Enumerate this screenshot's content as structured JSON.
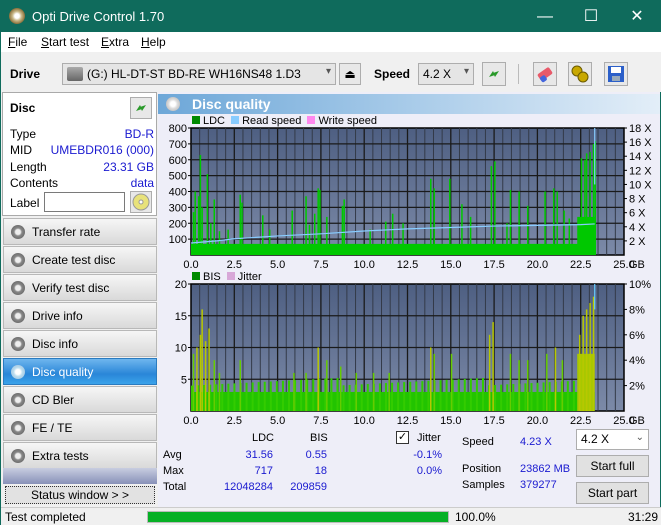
{
  "window": {
    "title": "Opti Drive Control 1.70",
    "minimize": "—",
    "maximize": "☐",
    "close": "✕"
  },
  "menu": [
    {
      "label": "File",
      "ul": "F",
      "rest": "ile"
    },
    {
      "label": "Start test",
      "ul": "S",
      "rest": "tart test"
    },
    {
      "label": "Extra",
      "ul": "E",
      "rest": "xtra"
    },
    {
      "label": "Help",
      "ul": "H",
      "rest": "elp"
    }
  ],
  "toolbar": {
    "drive_label": "Drive",
    "drive_value": "(G:)  HL-DT-ST BD-RE  WH16NS48 1.D3",
    "speed_label": "Speed",
    "speed_value": "4.2 X"
  },
  "disc": {
    "header": "Disc",
    "rows": [
      {
        "k": "Type",
        "v": "BD-R"
      },
      {
        "k": "MID",
        "v": "UMEBDR016 (000)"
      },
      {
        "k": "Length",
        "v": "23.31 GB"
      },
      {
        "k": "Contents",
        "v": "data"
      }
    ],
    "label_key": "Label",
    "label_value": ""
  },
  "nav": [
    {
      "label": "Transfer rate",
      "active": false
    },
    {
      "label": "Create test disc",
      "active": false
    },
    {
      "label": "Verify test disc",
      "active": false
    },
    {
      "label": "Drive info",
      "active": false
    },
    {
      "label": "Disc info",
      "active": false
    },
    {
      "label": "Disc quality",
      "active": true
    },
    {
      "label": "CD Bler",
      "active": false
    },
    {
      "label": "FE / TE",
      "active": false
    },
    {
      "label": "Extra tests",
      "active": false
    }
  ],
  "status_window_label": "Status window > >",
  "panel_title": "Disc quality",
  "chart_data": [
    {
      "type": "bar",
      "title": "LDC / Read speed",
      "legend": [
        {
          "name": "LDC",
          "color": "#00a000"
        },
        {
          "name": "Read speed",
          "color": "#88ccff"
        },
        {
          "name": "Write speed",
          "color": "#ff88ee"
        }
      ],
      "xlabel": "GB",
      "x_ticks": [
        "0.0",
        "2.5",
        "5.0",
        "7.5",
        "10.0",
        "12.5",
        "15.0",
        "17.5",
        "20.0",
        "22.5",
        "25.0"
      ],
      "xlim": [
        0,
        25
      ],
      "y_ticks": [
        "100",
        "200",
        "300",
        "400",
        "500",
        "600",
        "700",
        "800"
      ],
      "ylim": [
        0,
        800
      ],
      "y2_ticks": [
        "2 X",
        "4 X",
        "6 X",
        "8 X",
        "10 X",
        "12 X",
        "14 X",
        "16 X",
        "18 X"
      ],
      "y2lim": [
        0,
        18
      ],
      "ldc_peaks": [
        [
          0.1,
          270
        ],
        [
          0.2,
          400
        ],
        [
          0.4,
          370
        ],
        [
          0.5,
          630
        ],
        [
          0.6,
          300
        ],
        [
          0.9,
          510
        ],
        [
          1.1,
          200
        ],
        [
          1.3,
          350
        ],
        [
          1.6,
          150
        ],
        [
          2.1,
          160
        ],
        [
          2.8,
          380
        ],
        [
          2.9,
          330
        ],
        [
          4.1,
          250
        ],
        [
          4.5,
          160
        ],
        [
          5.8,
          280
        ],
        [
          6.6,
          370
        ],
        [
          6.8,
          190
        ],
        [
          7.1,
          260
        ],
        [
          7.3,
          420
        ],
        [
          7.4,
          410
        ],
        [
          7.8,
          240
        ],
        [
          8.7,
          310
        ],
        [
          8.8,
          350
        ],
        [
          10.3,
          160
        ],
        [
          11.2,
          210
        ],
        [
          11.6,
          260
        ],
        [
          12.2,
          200
        ],
        [
          13.8,
          480
        ],
        [
          14.0,
          420
        ],
        [
          14.9,
          480
        ],
        [
          15.6,
          320
        ],
        [
          16.1,
          240
        ],
        [
          17.3,
          560
        ],
        [
          17.5,
          590
        ],
        [
          18.2,
          200
        ],
        [
          18.4,
          410
        ],
        [
          18.9,
          400
        ],
        [
          19.4,
          310
        ],
        [
          20.4,
          400
        ],
        [
          20.9,
          420
        ],
        [
          21.1,
          400
        ],
        [
          21.5,
          280
        ],
        [
          21.8,
          230
        ],
        [
          22.5,
          610
        ],
        [
          22.7,
          600
        ],
        [
          22.8,
          640
        ],
        [
          23.0,
          650
        ],
        [
          23.2,
          700
        ],
        [
          23.3,
          717
        ]
      ],
      "ldc_baseline": 70,
      "read_speed": [
        [
          0,
          1.7
        ],
        [
          1.5,
          2.0
        ],
        [
          2.5,
          2.3
        ],
        [
          5,
          2.7
        ],
        [
          7.5,
          3.0
        ],
        [
          10,
          3.4
        ],
        [
          12.5,
          3.7
        ],
        [
          15,
          3.9
        ],
        [
          17.5,
          4.1
        ],
        [
          20,
          4.2
        ],
        [
          22.5,
          4.3
        ],
        [
          23.31,
          4.4
        ]
      ]
    },
    {
      "type": "bar",
      "title": "BIS / Jitter",
      "legend": [
        {
          "name": "BIS",
          "color": "#00a000"
        },
        {
          "name": "Jitter",
          "color": "#d8a8d8"
        }
      ],
      "xlabel": "GB",
      "x_ticks": [
        "0.0",
        "2.5",
        "5.0",
        "7.5",
        "10.0",
        "12.5",
        "15.0",
        "17.5",
        "20.0",
        "22.5",
        "25.0"
      ],
      "xlim": [
        0,
        25
      ],
      "y_ticks": [
        "5",
        "10",
        "15",
        "20"
      ],
      "ylim": [
        0,
        20
      ],
      "y2_ticks": [
        "2%",
        "4%",
        "6%",
        "8%",
        "10%"
      ],
      "y2lim": [
        0,
        10
      ],
      "bis_peaks": [
        [
          0.1,
          9
        ],
        [
          0.3,
          10
        ],
        [
          0.5,
          12
        ],
        [
          0.6,
          16
        ],
        [
          0.8,
          11
        ],
        [
          1.0,
          13
        ],
        [
          1.3,
          8
        ],
        [
          1.6,
          6
        ],
        [
          2.8,
          8
        ],
        [
          5.9,
          6
        ],
        [
          6.6,
          6
        ],
        [
          7.3,
          10
        ],
        [
          7.8,
          8
        ],
        [
          8.6,
          7
        ],
        [
          9.5,
          6
        ],
        [
          10.5,
          6
        ],
        [
          11.4,
          6
        ],
        [
          13.8,
          10
        ],
        [
          14.0,
          9
        ],
        [
          15.0,
          9
        ],
        [
          17.2,
          12
        ],
        [
          17.4,
          14
        ],
        [
          18.4,
          9
        ],
        [
          18.9,
          8
        ],
        [
          19.4,
          8
        ],
        [
          20.5,
          9
        ],
        [
          21.0,
          10
        ],
        [
          21.4,
          8
        ],
        [
          22.4,
          12
        ],
        [
          22.6,
          15
        ],
        [
          22.8,
          16
        ],
        [
          23.0,
          17
        ],
        [
          23.2,
          18
        ]
      ],
      "bis_baseline": 3
    }
  ],
  "stats": {
    "col_ldc": "LDC",
    "col_bis": "BIS",
    "jitter_label": "Jitter",
    "jitter_checked": true,
    "rows": [
      {
        "k": "Avg",
        "ldc": "31.56",
        "bis": "0.55",
        "jitter": "-0.1%"
      },
      {
        "k": "Max",
        "ldc": "717",
        "bis": "18",
        "jitter": "0.0%"
      },
      {
        "k": "Total",
        "ldc": "12048284",
        "bis": "209859",
        "jitter": ""
      }
    ],
    "speed_label": "Speed",
    "speed_value": "4.23 X",
    "position_label": "Position",
    "position_value": "23862 MB",
    "samples_label": "Samples",
    "samples_value": "379277",
    "speed_select": "4.2 X",
    "start_full": "Start full",
    "start_part": "Start part"
  },
  "statusbar": {
    "text": "Test completed",
    "progress_percent": 100,
    "progress_label": "100.0%",
    "elapsed": "31:29"
  }
}
